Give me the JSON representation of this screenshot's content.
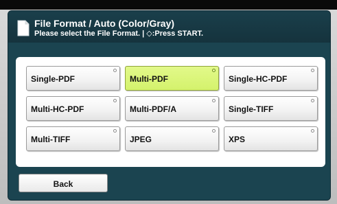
{
  "header": {
    "title": "File Format / Auto (Color/Gray)",
    "instruction": "Please select the File Format. | ◇:Press START."
  },
  "formats": [
    {
      "label": "Single-PDF",
      "selected": false
    },
    {
      "label": "Multi-PDF",
      "selected": true
    },
    {
      "label": "Single-HC-PDF",
      "selected": false
    },
    {
      "label": "Multi-HC-PDF",
      "selected": false
    },
    {
      "label": "Multi-PDF/A",
      "selected": false
    },
    {
      "label": "Single-TIFF",
      "selected": false
    },
    {
      "label": "Multi-TIFF",
      "selected": false
    },
    {
      "label": "JPEG",
      "selected": false
    },
    {
      "label": "XPS",
      "selected": false
    }
  ],
  "footer": {
    "back_label": "Back"
  },
  "colors": {
    "panel": "#1b4450",
    "selected": "#d4f26c"
  },
  "icons": {
    "header": "document-icon",
    "option_indicator": "radio-dot-icon"
  }
}
